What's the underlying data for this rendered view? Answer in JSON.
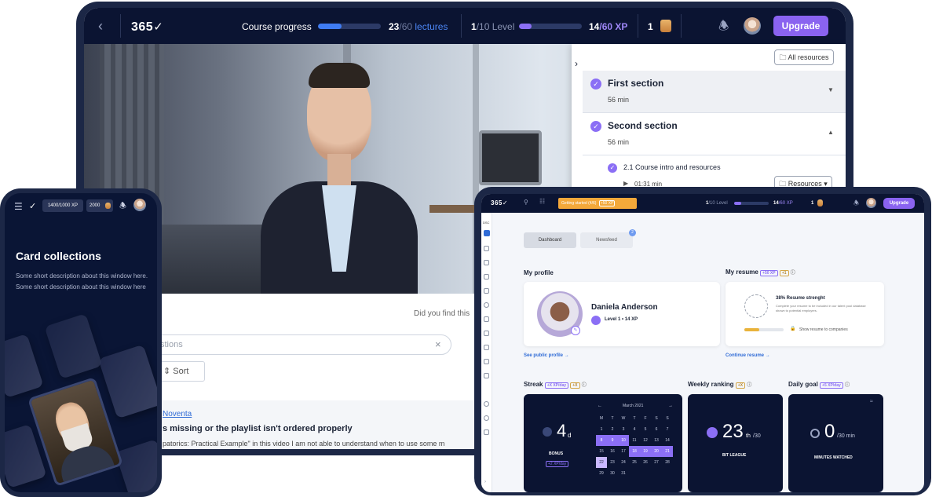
{
  "laptop": {
    "topbar": {
      "logo": "365",
      "course_progress_label": "Course progress",
      "lectures_done": "23",
      "lectures_total": "/60",
      "lectures_word": "lectures",
      "lectures_progress": 0.38,
      "level_current": "1",
      "level_total": "/10 Level",
      "level_progress": 0.2,
      "xp_current": "14",
      "xp_total": "/60 XP",
      "xp_progress": 0.23,
      "coins": "1",
      "upgrade_label": "Upgrade"
    },
    "panel": {
      "all_resources_label": "All resources",
      "sections": [
        {
          "title": "First section",
          "duration": "56 min"
        },
        {
          "title": "Second section",
          "duration": "56 min"
        }
      ],
      "lecture_title": "2.1 Course intro and resources",
      "lecture_duration": "01:31 min",
      "resources_label": "Resources"
    },
    "lower": {
      "feedback_text": "Did you find this",
      "search_placeholder": "stions",
      "sort_label": "Sort",
      "author_link": "Noventa",
      "question_title": "s missing or the playlist isn't ordered properly",
      "question_body": "patorics: Practical Example\" in this video I am not able to understand when to use some m"
    }
  },
  "phone": {
    "xp_badge": "1400/1000 XP",
    "coins_badge": "2000",
    "title": "Card collections",
    "description": "Some short description about this window here. Some short description about this window here"
  },
  "tablet": {
    "topbar": {
      "logo": "365",
      "getting_started": "Getting started (4/6)",
      "getting_started_xp": "+50 XP",
      "level_current": "1",
      "level_total": "/10 Level",
      "xp_current": "14",
      "xp_total": "/60 XP",
      "coins": "1",
      "upgrade_label": "Upgrade"
    },
    "sidebar_top_label": "DSC",
    "tabs": {
      "dashboard": "Dashboard",
      "newsfeed": "Newsfeed",
      "newsfeed_badge": "2"
    },
    "profile": {
      "heading": "My profile",
      "name": "Daniela Anderson",
      "level_line": "Level 1 • 14 XP",
      "link": "See public profile"
    },
    "resume": {
      "heading": "My resume",
      "xp_tag": "+50 XP",
      "coin_tag": "+1",
      "strength": "38% Resume strenght",
      "desc": "Complete your resume to be included in our talent pool database shown to potential employers.",
      "progress": 0.38,
      "show_label": "Show resume to companies",
      "link": "Continue resume"
    },
    "streak": {
      "heading": "Streak",
      "xp_tag": "+X XP/day",
      "coin_tag": "+X",
      "days": "4",
      "unit": "d",
      "bonus_label": "BONUS",
      "bonus_tag": "+2 XP/day",
      "month": "March 2021",
      "weekdays": [
        "M",
        "T",
        "W",
        "T",
        "F",
        "S",
        "S"
      ],
      "weeks": [
        [
          "1",
          "2",
          "3",
          "4",
          "5",
          "6",
          "7"
        ],
        [
          "8",
          "9",
          "10",
          "11",
          "12",
          "13",
          "14"
        ],
        [
          "15",
          "16",
          "17",
          "18",
          "19",
          "20",
          "21"
        ],
        [
          "22",
          "23",
          "24",
          "25",
          "26",
          "27",
          "28"
        ],
        [
          "29",
          "30",
          "31",
          "",
          "",
          "",
          ""
        ]
      ],
      "highlighted": [
        "8",
        "9",
        "10",
        "18",
        "19",
        "20",
        "21"
      ],
      "today": "22"
    },
    "weekly": {
      "heading": "Weekly ranking",
      "coin_tag": "+X",
      "rank": "23",
      "suffix": "th",
      "total": "/30",
      "league": "BIT LEAGUE"
    },
    "goal": {
      "heading": "Daily goal",
      "xp_tag": "+5 XP/day",
      "value": "0",
      "total": "/30 min",
      "label": "MINUTES WATCHED"
    }
  }
}
